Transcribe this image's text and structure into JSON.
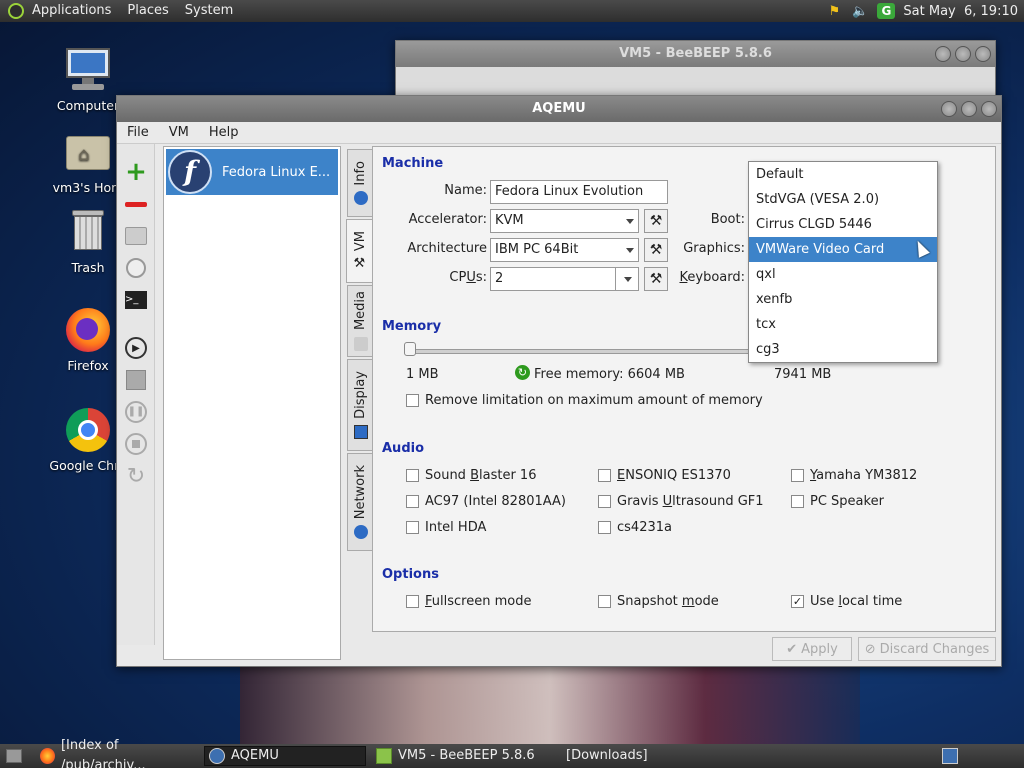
{
  "top_panel": {
    "menus": [
      "Applications",
      "Places",
      "System"
    ],
    "clock": "Sat May  6, 19:10",
    "tray_icons": [
      "bee-icon",
      "volume-icon",
      "updates-icon"
    ]
  },
  "desktop": {
    "icons": [
      {
        "label": "Computer",
        "icon": "computer-icon"
      },
      {
        "label": "vm3's Hom",
        "icon": "home-folder-icon"
      },
      {
        "label": "Trash",
        "icon": "trash-icon"
      },
      {
        "label": "Firefox",
        "icon": "firefox-icon"
      },
      {
        "label": "Google Chro",
        "icon": "chrome-icon"
      }
    ]
  },
  "bg_window": {
    "title": "VM5 - BeeBEEP 5.8.6"
  },
  "aqemu": {
    "title": "AQEMU",
    "menu": [
      "File",
      "VM",
      "Help"
    ],
    "vm_list": [
      {
        "name": "Fedora Linux E..."
      }
    ],
    "tabs": [
      "Info",
      "VM",
      "Media",
      "Display",
      "Network"
    ],
    "machine": {
      "heading": "Machine",
      "name_label": "Name:",
      "name_value": "Fedora Linux Evolution",
      "accelerator_label": "Accelerator:",
      "accelerator_value": "KVM",
      "architecture_label": "Architecture",
      "architecture_value": "IBM PC 64Bit",
      "cpus_label": "CPUs:",
      "cpus_value": "2",
      "boot_label": "Boot:",
      "graphics_label": "Graphics:",
      "keyboard_label": "Keyboard:"
    },
    "memory": {
      "heading": "Memory",
      "min": "1 MB",
      "free": "Free memory: 6604 MB",
      "max": "7941 MB",
      "slider_fraction": 0.01,
      "remove_limit": "Remove limitation on maximum amount of memory"
    },
    "audio": {
      "heading": "Audio",
      "cards": [
        {
          "label": "Sound Blaster 16",
          "checked": false
        },
        {
          "label": "ENSONIQ ES1370",
          "checked": false
        },
        {
          "label": "Yamaha YM3812",
          "checked": false
        },
        {
          "label": "AC97 (Intel 82801AA)",
          "checked": false
        },
        {
          "label": "Gravis Ultrasound GF1",
          "checked": false
        },
        {
          "label": "PC Speaker",
          "checked": false
        },
        {
          "label": "Intel HDA",
          "checked": false
        },
        {
          "label": "cs4231a",
          "checked": false
        }
      ]
    },
    "options": {
      "heading": "Options",
      "fullscreen": "Fullscreen mode",
      "snapshot": "Snapshot mode",
      "localtime": "Use local time"
    },
    "buttons": {
      "apply": "Apply",
      "discard": "Discard Changes"
    },
    "graphics_dropdown": {
      "options": [
        "Default",
        "StdVGA (VESA 2.0)",
        "Cirrus CLGD 5446",
        "VMWare Video Card",
        "qxl",
        "xenfb",
        "tcx",
        "cg3"
      ],
      "selected": "VMWare Video Card"
    }
  },
  "taskbar": {
    "tasks": [
      "[Index of /pub/archiv...",
      "AQEMU",
      "VM5 - BeeBEEP 5.8.6",
      "[Downloads]"
    ]
  },
  "colors": {
    "accent": "#3d83c9",
    "section": "#1a2ea8"
  }
}
